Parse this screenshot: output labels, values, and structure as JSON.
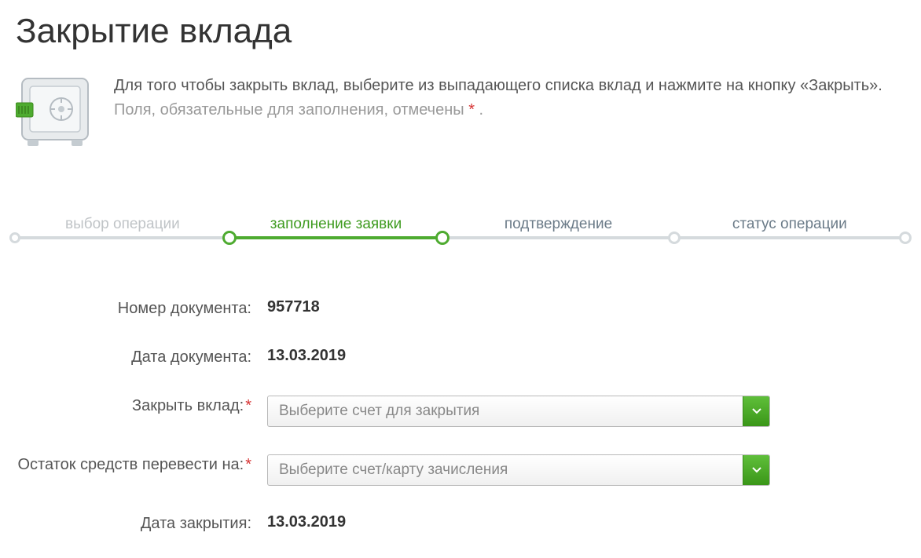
{
  "title": "Закрытие вклада",
  "intro": {
    "main": "Для того чтобы закрыть вклад, выберите из выпадающего списка вклад и нажмите на кнопку «Закрыть».",
    "note_prefix": "Поля, обязательные для заполнения, отмечены ",
    "note_suffix": " ."
  },
  "stepper": {
    "step1": "выбор операции",
    "step2": "заполнение заявки",
    "step3": "подтверждение",
    "step4": "статус операции",
    "active_index": 1
  },
  "form": {
    "doc_number": {
      "label": "Номер документа:",
      "value": "957718"
    },
    "doc_date": {
      "label": "Дата документа:",
      "value": "13.03.2019"
    },
    "close_deposit": {
      "label": "Закрыть вклад:",
      "placeholder": "Выберите счет для закрытия"
    },
    "transfer_to": {
      "label": "Остаток средств перевести на:",
      "placeholder": "Выберите счет/карту зачисления"
    },
    "close_date": {
      "label": "Дата закрытия:",
      "value": "13.03.2019"
    }
  },
  "colors": {
    "accent_green": "#4eab30",
    "required_red": "#d63333"
  }
}
